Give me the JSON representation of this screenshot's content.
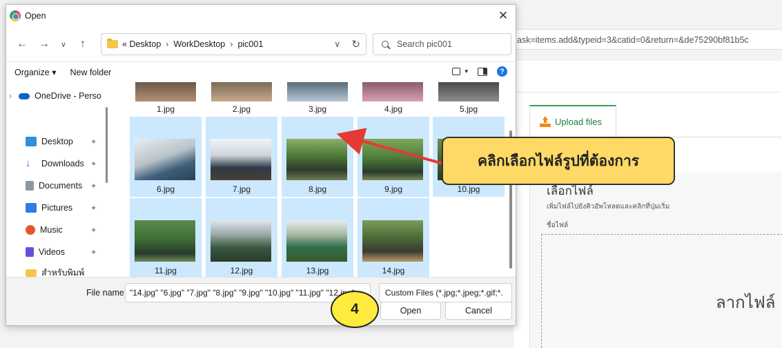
{
  "background": {
    "url_fragment": "ask=items.add&typeid=3&catid=0&return=&de75290bf81b5c",
    "upload_tab": "Upload files",
    "heading": "เลือกไฟล์",
    "subheading": "เพิ่มไฟล์ไปยังคิวอัพโหลดและคลิกที่ปุ่มเริ่ม",
    "file_name_label": "ชื่อไฟล์",
    "drop_text": "ลากไฟล์"
  },
  "dialog": {
    "title": "Open",
    "breadcrumb": [
      "Desktop",
      "WorkDesktop",
      "pic001"
    ],
    "breadcrumb_prefix": "«",
    "search_placeholder": "Search pic001",
    "toolbar": {
      "organize": "Organize ▾",
      "new_folder": "New folder"
    },
    "sidebar": [
      {
        "label": "OneDrive - Perso",
        "icon": "onedrive-icon",
        "color": "#0a64c6"
      },
      {
        "label": "Desktop",
        "icon": "desktop-icon",
        "color": "#2f8fd8"
      },
      {
        "label": "Downloads",
        "icon": "download-icon",
        "color": "#1a73e8"
      },
      {
        "label": "Documents",
        "icon": "documents-icon",
        "color": "#8a97a6"
      },
      {
        "label": "Pictures",
        "icon": "pictures-icon",
        "color": "#2a7fe0"
      },
      {
        "label": "Music",
        "icon": "music-icon",
        "color": "#e4572e"
      },
      {
        "label": "Videos",
        "icon": "videos-icon",
        "color": "#6c4fd6"
      },
      {
        "label": "สำหรับพิมพ์",
        "icon": "folder-icon",
        "color": "#f6c646"
      }
    ],
    "files_top": [
      "1.jpg",
      "2.jpg",
      "3.jpg",
      "4.jpg",
      "5.jpg"
    ],
    "files_row2": [
      "6.jpg",
      "7.jpg",
      "8.jpg",
      "9.jpg",
      "10.jpg"
    ],
    "files_row3": [
      "11.jpg",
      "12.jpg",
      "13.jpg",
      "14.jpg"
    ],
    "file_name_label": "File name:",
    "file_name_value": "\"14.jpg\" \"6.jpg\" \"7.jpg\" \"8.jpg\" \"9.jpg\" \"10.jpg\" \"11.jpg\" \"12.jpg\"",
    "filter": "Custom Files (*.jpg;*.jpeg;*.gif;*.",
    "open_button": "Open",
    "cancel_button": "Cancel"
  },
  "annotations": {
    "callout": "คลิกเลือกไฟล์รูปที่ต้องการ",
    "step": "4"
  }
}
